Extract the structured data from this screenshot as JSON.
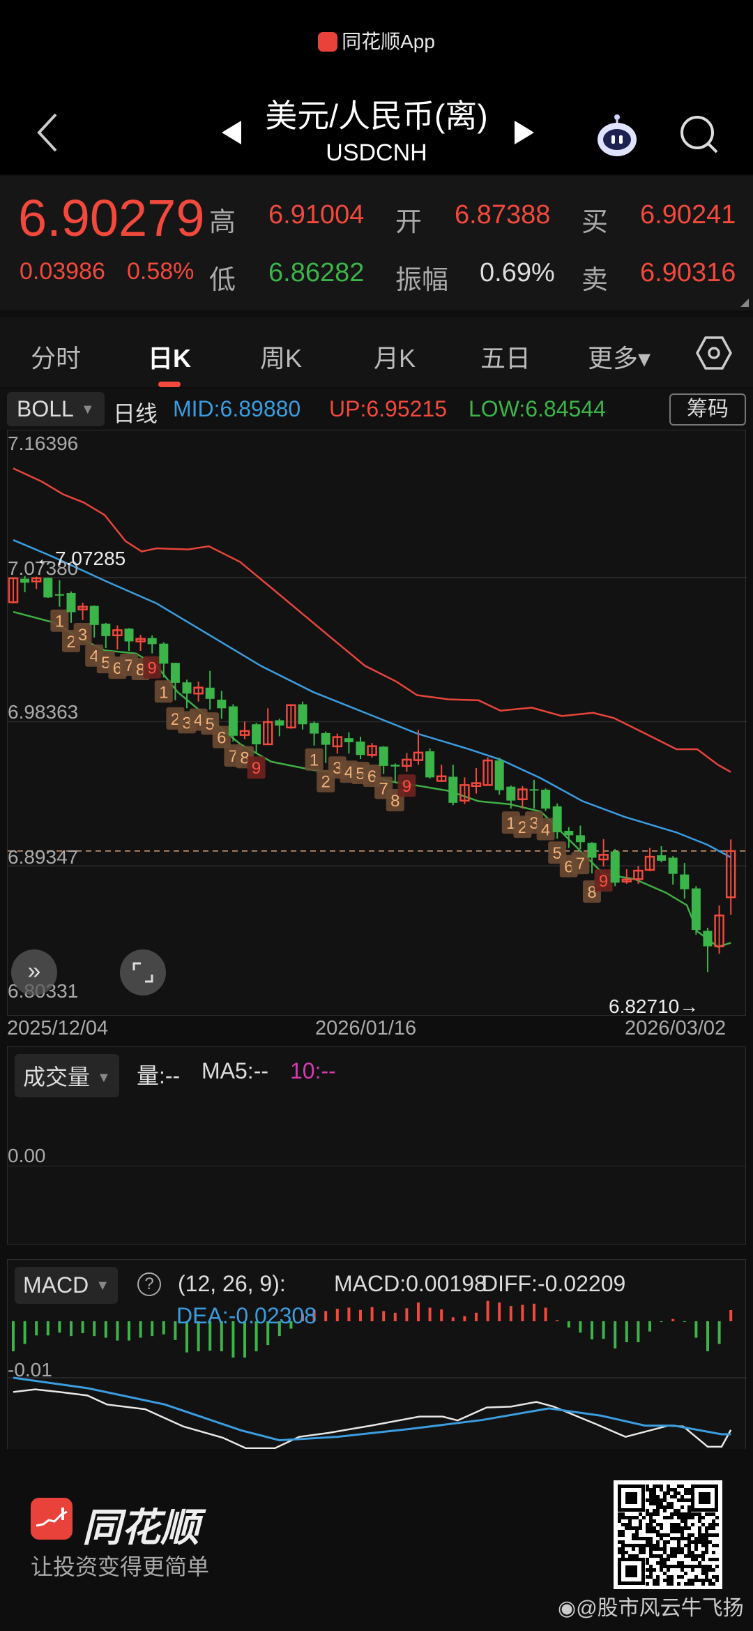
{
  "app_title": "同花顺App",
  "header": {
    "title": "美元/人民币(离)",
    "code": "USDCNH"
  },
  "quote": {
    "price": "6.90279",
    "change": "0.03986",
    "change_pct": "0.58%",
    "high_label": "高",
    "high": "6.91004",
    "low_label": "低",
    "low": "6.86282",
    "open_label": "开",
    "open": "6.87388",
    "amp_label": "振幅",
    "amp": "0.69%",
    "bid_label": "买",
    "bid": "6.90241",
    "ask_label": "卖",
    "ask": "6.90316"
  },
  "tabs": [
    {
      "label": "分时"
    },
    {
      "label": "日K"
    },
    {
      "label": "周K"
    },
    {
      "label": "月K"
    },
    {
      "label": "五日"
    },
    {
      "label": "更多▾"
    }
  ],
  "indicator": {
    "name": "BOLL",
    "period": "日线",
    "mid": "MID:6.89880",
    "up": "UP:6.95215",
    "low": "LOW:6.84544",
    "chip_button": "筹码"
  },
  "colors": {
    "up": "#f2493c",
    "down": "#3bb54a",
    "mid": "#3b9de0",
    "upper": "#e8453a",
    "lower": "#3fae45",
    "td": "#6b4a33",
    "td_text": "#f2b27a"
  },
  "chart_data": [
    {
      "type": "candlestick",
      "title": "USDCNH 日K BOLL",
      "ylim": [
        6.80331,
        7.16396
      ],
      "y_ticks": [
        "7.16396",
        "7.07380",
        "6.98363",
        "6.89347",
        "6.80331"
      ],
      "y_tick_values": [
        7.16396,
        7.0738,
        6.98363,
        6.89347,
        6.80331
      ],
      "x_ticks": [
        {
          "index": 0,
          "label": "2025/12/04"
        },
        {
          "index": 31,
          "label": "2026/01/16"
        },
        {
          "index": 62,
          "label": "2026/03/02"
        }
      ],
      "period_high_label": "←7.07285",
      "period_low_label": "6.82710→",
      "last_price": 6.90279,
      "ohlc": [
        [
          7.0583,
          7.0738,
          7.0576,
          7.0733
        ],
        [
          7.073,
          7.0747,
          7.0646,
          7.0705
        ],
        [
          7.0713,
          7.0743,
          7.0666,
          7.0733
        ],
        [
          7.0735,
          7.0738,
          7.061,
          7.0613
        ],
        [
          7.0633,
          7.0721,
          7.0555,
          7.063
        ],
        [
          7.0641,
          7.065,
          7.0454,
          7.0521
        ],
        [
          7.0538,
          7.058,
          7.0471,
          7.0555
        ],
        [
          7.056,
          7.0563,
          7.0363,
          7.0441
        ],
        [
          7.0449,
          7.0454,
          7.0296,
          7.0371
        ],
        [
          7.0376,
          7.0438,
          7.0287,
          7.0408
        ],
        [
          7.0418,
          7.0421,
          7.0279,
          7.0338
        ],
        [
          7.0338,
          7.0379,
          7.0279,
          7.0354
        ],
        [
          7.0359,
          7.0376,
          7.0263,
          7.0321
        ],
        [
          7.0324,
          7.0333,
          7.0112,
          7.0199
        ],
        [
          7.0204,
          7.0204,
          6.997,
          7.0079
        ],
        [
          7.0082,
          7.0099,
          6.992,
          7.0012
        ],
        [
          7.0012,
          7.0087,
          6.9962,
          7.0049
        ],
        [
          7.0049,
          7.0154,
          6.9912,
          6.9979
        ],
        [
          6.9974,
          7.0029,
          6.9854,
          6.992
        ],
        [
          6.9932,
          6.9945,
          6.9712,
          6.9748
        ],
        [
          6.9753,
          6.9837,
          6.9728,
          6.9778
        ],
        [
          6.982,
          6.9829,
          6.9637,
          6.9695
        ],
        [
          6.9695,
          6.992,
          6.9692,
          6.9834
        ],
        [
          6.9845,
          6.9854,
          6.9745,
          6.9812
        ],
        [
          6.98,
          6.9945,
          6.9792,
          6.994
        ],
        [
          6.9945,
          6.9962,
          6.9787,
          6.982
        ],
        [
          6.9829,
          6.9837,
          6.9687,
          6.9762
        ],
        [
          6.9765,
          6.9775,
          6.9578,
          6.9692
        ],
        [
          6.9682,
          6.9762,
          6.9637,
          6.974
        ],
        [
          6.9733,
          6.977,
          6.9637,
          6.9708
        ],
        [
          6.9712,
          6.9742,
          6.9603,
          6.9628
        ],
        [
          6.9628,
          6.9703,
          6.9612,
          6.9683
        ],
        [
          6.968,
          6.9683,
          6.951,
          6.956
        ],
        [
          6.9567,
          6.9575,
          6.9459,
          6.9556
        ],
        [
          6.956,
          6.964,
          6.9524,
          6.9599
        ],
        [
          6.9596,
          6.9784,
          6.9567,
          6.9643
        ],
        [
          6.9651,
          6.9669,
          6.9481,
          6.9488
        ],
        [
          6.9466,
          6.9567,
          6.9459,
          6.9495
        ],
        [
          6.9492,
          6.9567,
          6.9314,
          6.9329
        ],
        [
          6.9343,
          6.9488,
          6.9322,
          6.944
        ],
        [
          6.9434,
          6.9546,
          6.9387,
          6.9452
        ],
        [
          6.944,
          6.9614,
          6.9437,
          6.9594
        ],
        [
          6.9594,
          6.9611,
          6.938,
          6.9408
        ],
        [
          6.943,
          6.9437,
          6.9293,
          6.9343
        ],
        [
          6.9351,
          6.9434,
          6.9293,
          6.9413
        ],
        [
          6.9414,
          6.9473,
          6.9293,
          6.9406
        ],
        [
          6.9411,
          6.9419,
          6.9278,
          6.9293
        ],
        [
          6.9307,
          6.9325,
          6.9105,
          6.9145
        ],
        [
          6.9154,
          6.9177,
          6.9047,
          6.9126
        ],
        [
          6.9126,
          6.9187,
          6.904,
          6.9083
        ],
        [
          6.9079,
          6.9083,
          6.8888,
          6.8986
        ],
        [
          6.8975,
          6.9102,
          6.8931,
          6.9004
        ],
        [
          6.9025,
          6.904,
          6.8808,
          6.883
        ],
        [
          6.8837,
          6.8914,
          6.8823,
          6.885
        ],
        [
          6.8852,
          6.8934,
          6.8823,
          6.8905
        ],
        [
          6.891,
          6.9047,
          6.8902,
          6.8992
        ],
        [
          6.9001,
          6.9058,
          6.8957,
          6.8967
        ],
        [
          6.8986,
          6.8996,
          6.8818,
          6.8885
        ],
        [
          6.8881,
          6.8953,
          6.8729,
          6.8789
        ],
        [
          6.8794,
          6.8808,
          6.8505,
          6.8534
        ],
        [
          6.8529,
          6.8548,
          6.8271,
          6.8432
        ],
        [
          6.8432,
          6.8688,
          6.8385,
          6.8625
        ],
        [
          6.87388,
          6.91004,
          6.86282,
          6.90279
        ]
      ],
      "boll_up": [
        [
          0,
          7.142
        ],
        [
          2.5,
          7.1336
        ],
        [
          4.3,
          7.1258
        ],
        [
          6.1,
          7.1206
        ],
        [
          7.9,
          7.1128
        ],
        [
          9.7,
          7.0965
        ],
        [
          11.1,
          7.09
        ],
        [
          12.4,
          7.092
        ],
        [
          15.1,
          7.0913
        ],
        [
          16.9,
          7.0933
        ],
        [
          19.6,
          7.0835
        ],
        [
          22.3,
          7.0673
        ],
        [
          25,
          7.051
        ],
        [
          27.7,
          7.0347
        ],
        [
          30.4,
          7.0185
        ],
        [
          33.1,
          7.0087
        ],
        [
          34.9,
          7.0002
        ],
        [
          37.6,
          6.9976
        ],
        [
          40.2,
          6.997
        ],
        [
          42.1,
          6.9905
        ],
        [
          44.8,
          6.9924
        ],
        [
          47.4,
          6.9872
        ],
        [
          50.1,
          6.9892
        ],
        [
          51.9,
          6.9859
        ],
        [
          54.6,
          6.9762
        ],
        [
          57.3,
          6.9664
        ],
        [
          59.1,
          6.9664
        ],
        [
          60.9,
          6.9566
        ],
        [
          62,
          6.95215
        ]
      ],
      "boll_mid": [
        [
          0,
          7.0972
        ],
        [
          3.4,
          7.0868
        ],
        [
          7.9,
          7.0718
        ],
        [
          12.4,
          7.0575
        ],
        [
          16.9,
          7.038
        ],
        [
          21.4,
          7.0185
        ],
        [
          25.9,
          7.0022
        ],
        [
          30.4,
          6.9892
        ],
        [
          34.9,
          6.9762
        ],
        [
          39.4,
          6.9664
        ],
        [
          42.1,
          6.9599
        ],
        [
          45.6,
          6.9482
        ],
        [
          49.2,
          6.9339
        ],
        [
          52.8,
          6.9242
        ],
        [
          57.3,
          6.9144
        ],
        [
          60,
          6.9066
        ],
        [
          62,
          6.8988
        ]
      ],
      "boll_low": [
        [
          0,
          7.0523
        ],
        [
          3.4,
          7.0458
        ],
        [
          6.1,
          7.0347
        ],
        [
          7.9,
          7.0282
        ],
        [
          10.6,
          7.0263
        ],
        [
          12.4,
          7.0185
        ],
        [
          14.2,
          7.0022
        ],
        [
          16.9,
          6.9859
        ],
        [
          19.6,
          6.9697
        ],
        [
          22.3,
          6.9586
        ],
        [
          25.9,
          6.9534
        ],
        [
          30.4,
          6.9502
        ],
        [
          33.1,
          6.9456
        ],
        [
          34.9,
          6.9437
        ],
        [
          37.6,
          6.9404
        ],
        [
          40.2,
          6.9339
        ],
        [
          42.9,
          6.932
        ],
        [
          45.6,
          6.9274
        ],
        [
          47.4,
          6.9144
        ],
        [
          49.2,
          6.9014
        ],
        [
          51,
          6.8884
        ],
        [
          53.7,
          6.8852
        ],
        [
          56.4,
          6.8767
        ],
        [
          58.2,
          6.8689
        ],
        [
          59.1,
          6.8526
        ],
        [
          60.9,
          6.8428
        ],
        [
          62,
          6.84544
        ]
      ],
      "td_sequences": [
        4,
        13,
        26,
        43
      ],
      "td_labels": [
        "1",
        "2",
        "3",
        "4",
        "5",
        "6",
        "7",
        "8",
        "9"
      ]
    },
    {
      "type": "bar",
      "title": "成交量",
      "y_ticks": [
        "0.00"
      ],
      "values": []
    },
    {
      "type": "macd",
      "params": "(12, 26, 9):",
      "y_ticks": [
        "-0.01"
      ],
      "histogram": [
        -0.0053,
        -0.004,
        -0.0025,
        -0.0025,
        -0.002,
        -0.0026,
        -0.0021,
        -0.0026,
        -0.0029,
        -0.0034,
        -0.0034,
        -0.0029,
        -0.0026,
        -0.0023,
        -0.0033,
        -0.0055,
        -0.0053,
        -0.0052,
        -0.0053,
        -0.0064,
        -0.0064,
        -0.0053,
        -0.0042,
        -0.0026,
        -0.0013,
        0.0013,
        0.002,
        0.0018,
        0.0022,
        0.0024,
        0.002,
        0.0025,
        0.0018,
        0.0015,
        0.0023,
        0.0033,
        0.0024,
        0.0021,
        0.0007,
        0.0009,
        0.0015,
        0.0036,
        0.0033,
        0.0027,
        0.0029,
        0.0031,
        0.0024,
        0.0002,
        -0.0011,
        -0.002,
        -0.0032,
        -0.0031,
        -0.0048,
        -0.0037,
        -0.0037,
        -0.0018,
        -0.0001,
        0.0004,
        -0.0001,
        -0.0029,
        -0.0053,
        -0.004,
        0.00198
      ],
      "diff": [
        [
          0,
          -0.0133
        ],
        [
          1.9,
          -0.0127
        ],
        [
          4,
          -0.0133
        ],
        [
          6.4,
          -0.0141
        ],
        [
          8.1,
          -0.0162
        ],
        [
          11.4,
          -0.0173
        ],
        [
          14.7,
          -0.0213
        ],
        [
          18.1,
          -0.0239
        ],
        [
          20.1,
          -0.0268
        ],
        [
          22.6,
          -0.0268
        ],
        [
          24.7,
          -0.0237
        ],
        [
          27.2,
          -0.0228
        ],
        [
          30.9,
          -0.0211
        ],
        [
          35.1,
          -0.019
        ],
        [
          37.1,
          -0.019
        ],
        [
          38.4,
          -0.0199
        ],
        [
          40.9,
          -0.0169
        ],
        [
          43,
          -0.0167
        ],
        [
          45.2,
          -0.0156
        ],
        [
          46.7,
          -0.0167
        ],
        [
          50.4,
          -0.0208
        ],
        [
          52.9,
          -0.0237
        ],
        [
          56.6,
          -0.0211
        ],
        [
          57.9,
          -0.0213
        ],
        [
          60,
          -0.026
        ],
        [
          61.2,
          -0.026
        ],
        [
          62,
          -0.02209
        ]
      ],
      "dea": [
        [
          0,
          -0.01
        ],
        [
          6.4,
          -0.0124
        ],
        [
          13.1,
          -0.0162
        ],
        [
          19.7,
          -0.0222
        ],
        [
          23,
          -0.0245
        ],
        [
          28,
          -0.0237
        ],
        [
          34.2,
          -0.0219
        ],
        [
          40.5,
          -0.0198
        ],
        [
          46.3,
          -0.0171
        ],
        [
          50.8,
          -0.0188
        ],
        [
          54.6,
          -0.0211
        ],
        [
          57.1,
          -0.0211
        ],
        [
          61.2,
          -0.0231
        ],
        [
          62,
          -0.02308
        ]
      ]
    }
  ],
  "volume": {
    "name": "成交量",
    "vol": "量:--",
    "ma5": "MA5:--",
    "ma10": "10:--"
  },
  "macd": {
    "name": "MACD",
    "help": "?",
    "params": "(12, 26, 9):",
    "macd": "MACD:0.00198",
    "diff": "DIFF:-0.02209",
    "dea": "DEA:-0.02308"
  },
  "footer": {
    "brand": "同花顺",
    "slogan": "让投资变得更简单",
    "watermark": "@股市风云牛飞扬"
  }
}
